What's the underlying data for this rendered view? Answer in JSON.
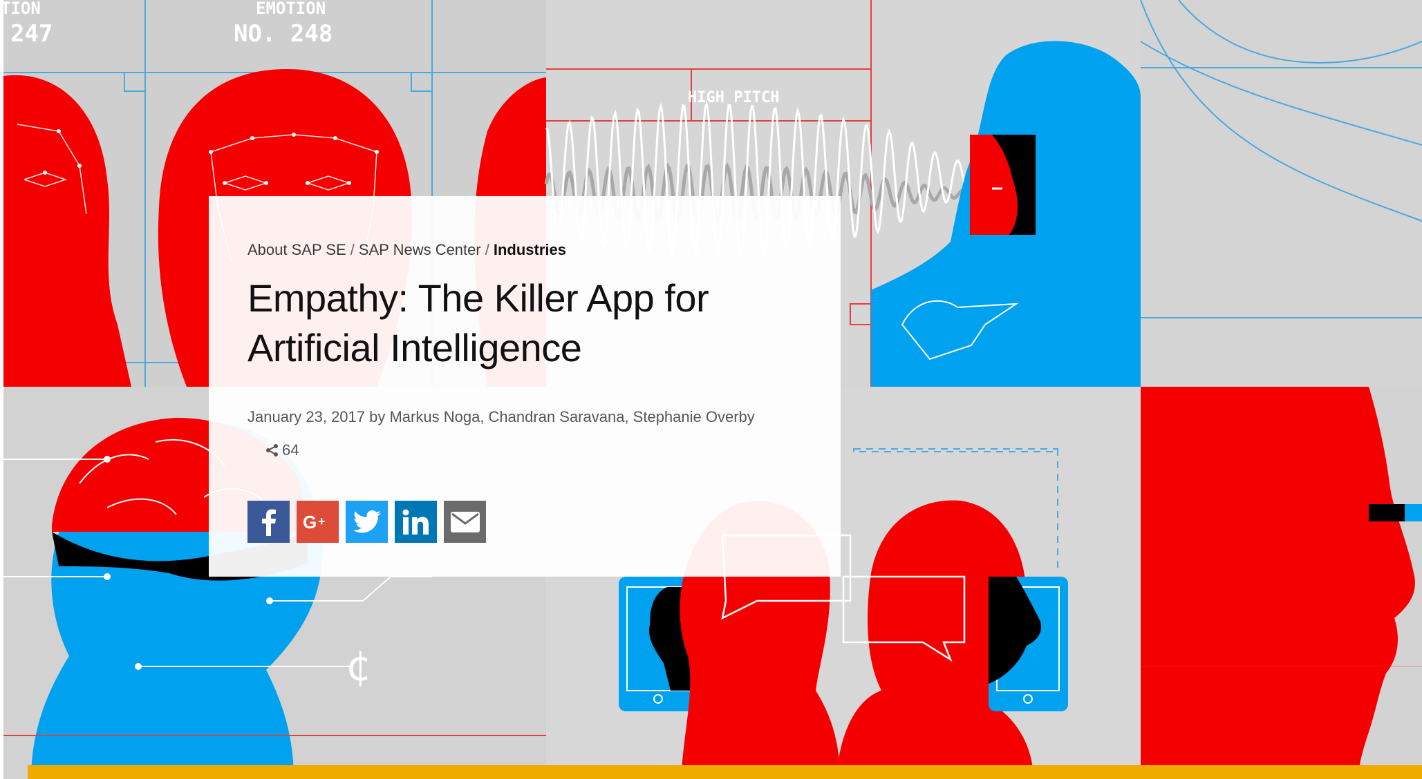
{
  "hero_art": {
    "emotion_label_left": "TION",
    "emotion_number_left": "247",
    "emotion_label_right": "EMOTION",
    "emotion_number_right": "NO. 248",
    "pitch_label": "HIGH PITCH",
    "colors": {
      "red": "#f50000",
      "blue": "#00a2f0",
      "black": "#000000",
      "background": "#d3d3d3"
    }
  },
  "breadcrumb": {
    "items": [
      "About SAP SE",
      "SAP News Center"
    ],
    "separator": "/",
    "current": "Industries"
  },
  "article": {
    "title": "Empathy: The Killer App for Artificial Intelligence",
    "byline": "January 23, 2017 by Markus Noga, Chandran Saravana, Stephanie Overby",
    "share_count": "64",
    "share_icon": "share-icon"
  },
  "social": [
    {
      "name": "facebook",
      "icon": "facebook-icon",
      "color": "#3b5998"
    },
    {
      "name": "google-plus",
      "icon": "google-plus-icon",
      "color": "#dd4b39"
    },
    {
      "name": "twitter",
      "icon": "twitter-icon",
      "color": "#1da1f2"
    },
    {
      "name": "linkedin",
      "icon": "linkedin-icon",
      "color": "#0077b5"
    },
    {
      "name": "email",
      "icon": "email-icon",
      "color": "#6b6b6b"
    }
  ],
  "accent_bar_color": "#f0ab00"
}
